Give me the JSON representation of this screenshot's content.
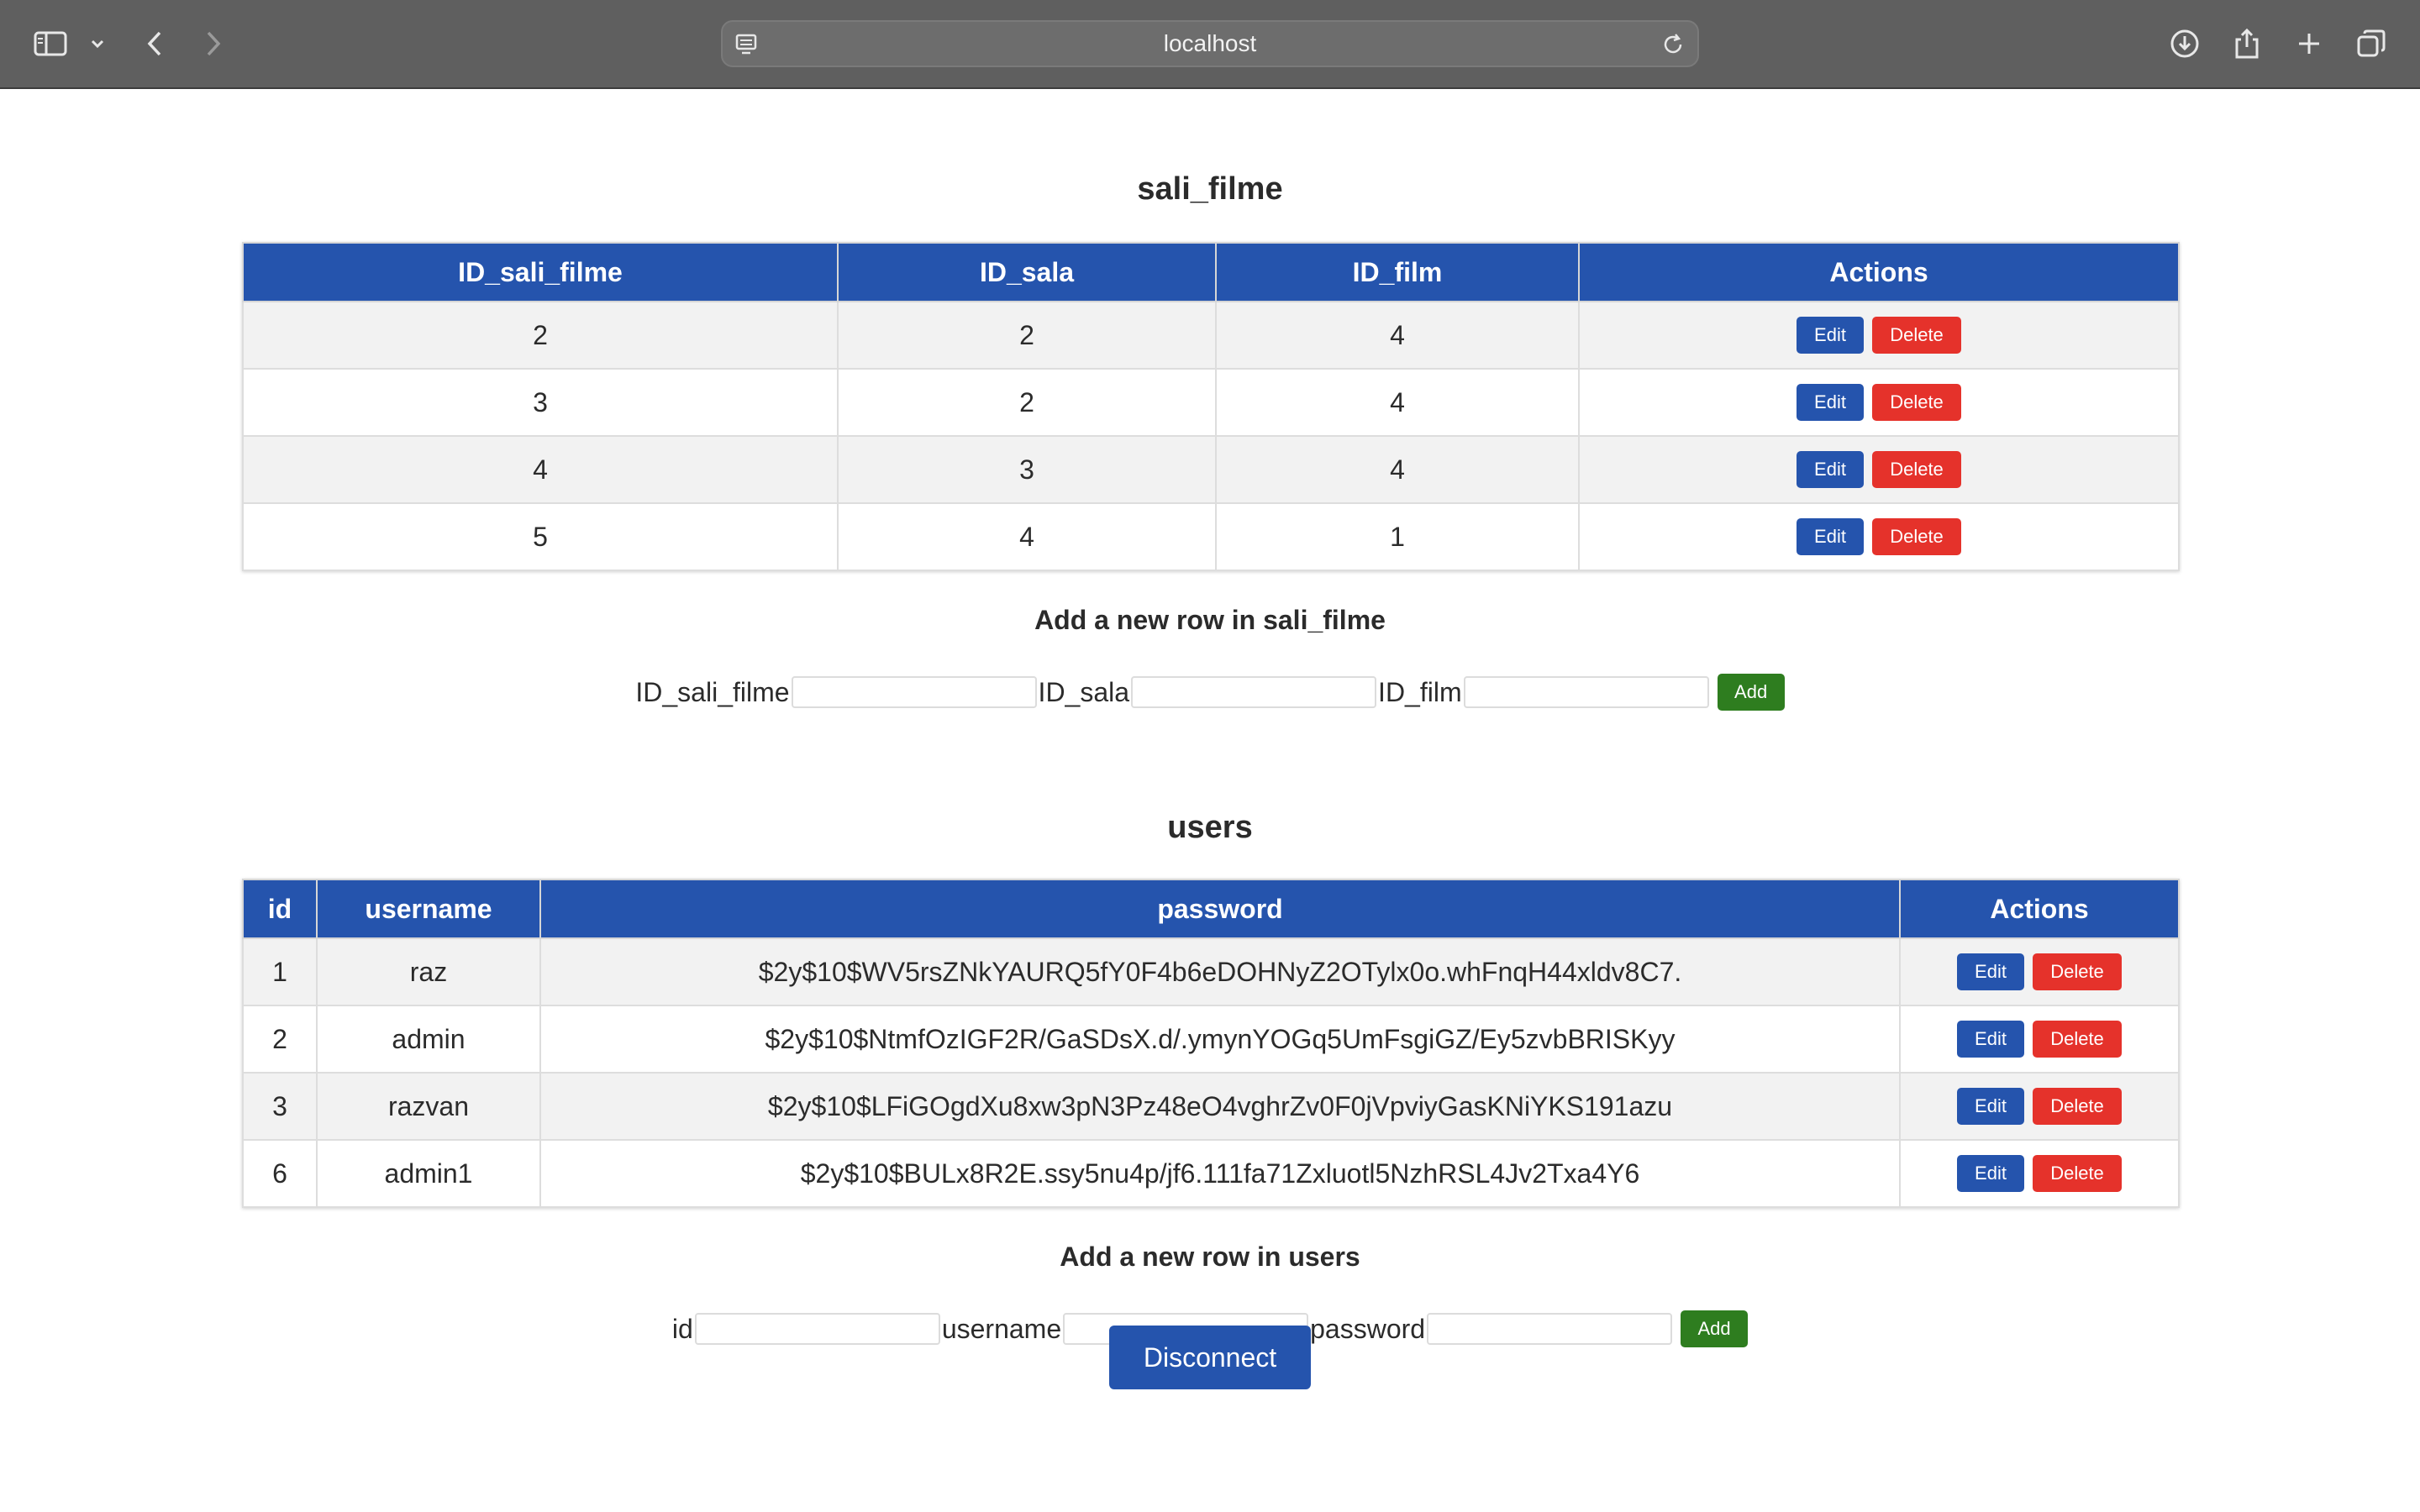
{
  "browser": {
    "url": "localhost",
    "icons": [
      "sidebar-icon",
      "chevron-down-icon",
      "back-icon",
      "forward-icon",
      "site-settings-icon",
      "reload-icon",
      "download-icon",
      "share-icon",
      "new-tab-icon",
      "tabs-overview-icon"
    ]
  },
  "colors": {
    "header": "#2554ad",
    "edit": "#2554ad",
    "delete": "#e5322b",
    "add": "#2e7d1f",
    "disconnect": "#2554ad"
  },
  "sali_filme": {
    "title": "sali_filme",
    "columns": [
      "ID_sali_filme",
      "ID_sala",
      "ID_film",
      "Actions"
    ],
    "rows": [
      [
        "2",
        "2",
        "4"
      ],
      [
        "3",
        "2",
        "4"
      ],
      [
        "4",
        "3",
        "4"
      ],
      [
        "5",
        "4",
        "1"
      ]
    ],
    "edit_label": "Edit",
    "delete_label": "Delete",
    "add_title": "Add a new row in sali_filme",
    "fields": [
      "ID_sali_filme",
      "ID_sala",
      "ID_film"
    ],
    "add_label": "Add"
  },
  "users": {
    "title": "users",
    "columns": [
      "id",
      "username",
      "password",
      "Actions"
    ],
    "rows": [
      [
        "1",
        "raz",
        "$2y$10$WV5rsZNkYAURQ5fY0F4b6eDOHNyZ2OTylx0o.whFnqH44xldv8C7."
      ],
      [
        "2",
        "admin",
        "$2y$10$NtmfOzIGF2R/GaSDsX.d/.ymynYOGq5UmFsgiGZ/Ey5zvbBRISKyy"
      ],
      [
        "3",
        "razvan",
        "$2y$10$LFiGOgdXu8xw3pN3Pz48eO4vghrZv0F0jVpviyGasKNiYKS191azu"
      ],
      [
        "6",
        "admin1",
        "$2y$10$BULx8R2E.ssy5nu4p/jf6.111fa71Zxluotl5NzhRSL4Jv2Txa4Y6"
      ]
    ],
    "edit_label": "Edit",
    "delete_label": "Delete",
    "add_title": "Add a new row in users",
    "fields": [
      "id",
      "username",
      "password"
    ],
    "add_label": "Add"
  },
  "disconnect_label": "Disconnect"
}
